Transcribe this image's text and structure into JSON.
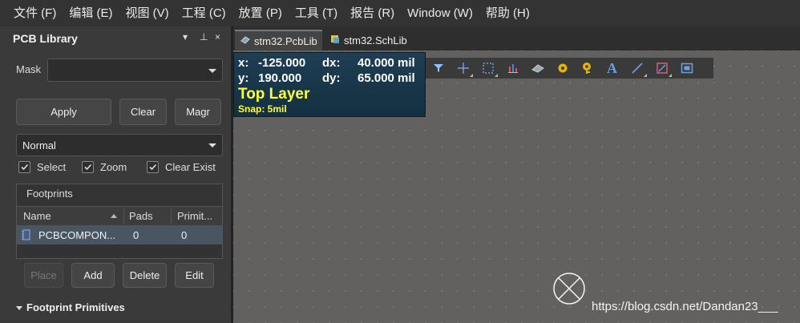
{
  "menubar": {
    "items": [
      "文件 (F)",
      "编辑 (E)",
      "视图 (V)",
      "工程 (C)",
      "放置 (P)",
      "工具 (T)",
      "报告 (R)",
      "Window (W)",
      "帮助 (H)"
    ]
  },
  "panel": {
    "title": "PCB Library",
    "controls": [
      "▾",
      "⊥",
      "×"
    ],
    "mask_label": "Mask",
    "mask_value": "",
    "buttons": {
      "apply": "Apply",
      "clear": "Clear",
      "magnify": "Magr"
    },
    "mode_value": "Normal",
    "checks": [
      {
        "label": "Select",
        "checked": true
      },
      {
        "label": "Zoom",
        "checked": true
      },
      {
        "label": "Clear Exist",
        "checked": true
      }
    ],
    "footprints": {
      "title": "Footprints",
      "columns": [
        "Name",
        "Pads",
        "Primit..."
      ],
      "rows": [
        {
          "name": "PCBCOMPON...",
          "pads": "0",
          "primitives": "0"
        }
      ]
    },
    "actions": {
      "place": "Place",
      "add": "Add",
      "delete": "Delete",
      "edit": "Edit"
    },
    "primitives_title": "Footprint Primitives"
  },
  "tabs": [
    {
      "label": "stm32.PcbLib",
      "icon": "pcb-doc-icon",
      "active": true
    },
    {
      "label": "stm32.SchLib",
      "icon": "sch-doc-icon",
      "active": false
    }
  ],
  "hud": {
    "x_label": "x:",
    "x_value": "-125.000",
    "dx_label": "dx:",
    "dx_value": "40.000 mil",
    "y_label": "y:",
    "y_value": "190.000",
    "dy_label": "dy:",
    "dy_value": "65.000 mil",
    "layer": "Top Layer",
    "snap": "Snap: 5mil"
  },
  "toolbar": {
    "tools": [
      "filter-icon",
      "crosshair-icon",
      "select-rect-icon",
      "chart-icon",
      "component-icon",
      "pad-icon",
      "via-icon",
      "text-icon",
      "line-icon",
      "rect-icon",
      "region-icon"
    ]
  },
  "watermark": "https://blog.csdn.net/Dandan23___",
  "colors": {
    "canvas": "#636060",
    "hud_text_yellow": "#ffff33",
    "selected_row": "#4a5562"
  }
}
